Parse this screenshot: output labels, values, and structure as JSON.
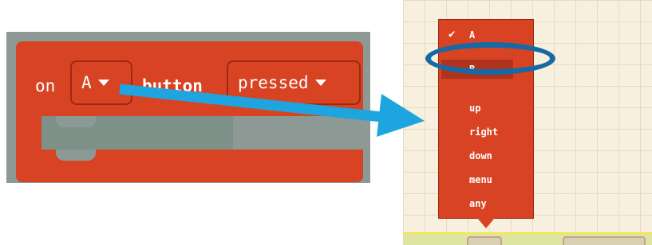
{
  "block": {
    "on_label": "on",
    "button_value": "A",
    "button_label": "button",
    "event_value": "pressed"
  },
  "dropdown": {
    "items": [
      {
        "label": "A",
        "checked": true
      },
      {
        "label": "B",
        "highlighted": true
      },
      {
        "label": "up"
      },
      {
        "label": "right"
      },
      {
        "label": "down"
      },
      {
        "label": "menu"
      },
      {
        "label": "any"
      }
    ]
  },
  "colors": {
    "block_red": "#d84423",
    "arrow_blue": "#1ea5df",
    "highlight_oval": "#1769a6"
  }
}
